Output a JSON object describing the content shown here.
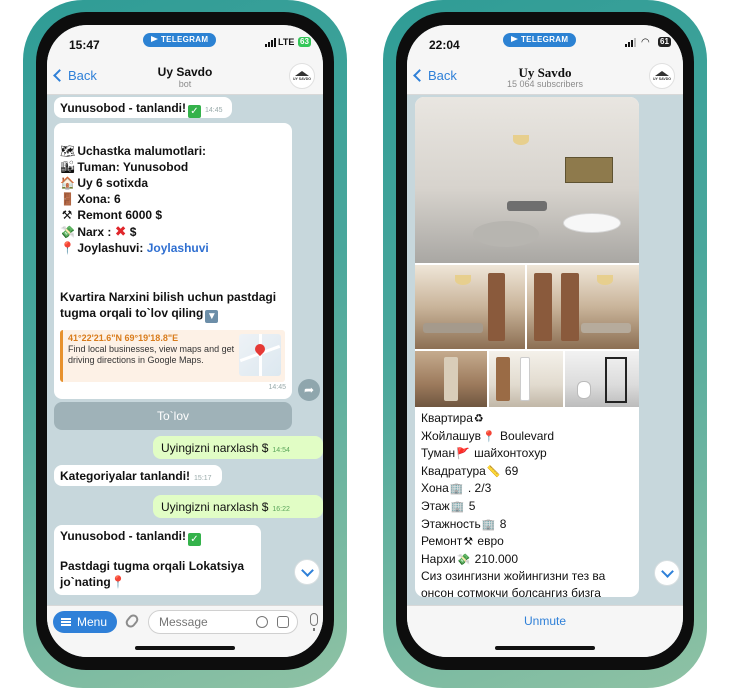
{
  "colors": {
    "accent": "#2f80d8",
    "outgoing": "#e1fdc5",
    "check": "#34b24b",
    "phone_frame": "#2f9c96"
  },
  "left": {
    "status": {
      "time": "15:47",
      "network": "LTE",
      "battery": "63",
      "app_pill": "TELEGRAM"
    },
    "nav": {
      "back": "Back",
      "title": "Uy Savdo",
      "subtitle": "bot"
    },
    "messages": {
      "m1": {
        "text": "Yunusobod - tanlandi!",
        "time": "14:45"
      },
      "m2": {
        "line1": "Uchastka malumotlari:",
        "line2": "Tuman: Yunusobod",
        "line3": "Uy 6 sotixda",
        "line4": "Xona: 6",
        "line5": "Remont 6000 $",
        "line6": "Narx :",
        "line6b": "$",
        "line7": "Joylashuvi:",
        "line7_link": "Joylashuvi",
        "para1": "Kvartira Narxini bilish uchun pastdagi",
        "para2": "tugma orqali to`lov qiling",
        "map_coords": "41°22'21.6\"N 69°19'18.8\"E",
        "map_desc": "Find local businesses, view maps and get driving directions in Google Maps.",
        "time": "14:45"
      },
      "button": "To`lov",
      "m3": {
        "text": "Uyingizni narxlash $",
        "time": "14:54"
      },
      "m4": {
        "text": "Kategoriyalar tanlandi!",
        "time": "15:17"
      },
      "m5": {
        "text": "Uyingizni narxlash $",
        "time": "16:22"
      },
      "m6": {
        "line1": "Yunusobod - tanlandi!",
        "line2": "Pastdagi tugma orqali Lokatsiya",
        "line3": "jo`nating",
        "time": "16:22"
      }
    },
    "input": {
      "menu": "Menu",
      "placeholder": "Message"
    }
  },
  "right": {
    "status": {
      "time": "22:04",
      "battery": "61",
      "app_pill": "TELEGRAM"
    },
    "nav": {
      "back": "Back",
      "title": "Uy Savdo",
      "subtitle": "15 064 subscribers"
    },
    "post": [
      {
        "label": "Квартира",
        "icon": "♻",
        "value": ""
      },
      {
        "label": "Жойлашув",
        "icon": "📍",
        "value": "Boulevard"
      },
      {
        "label": "Туман",
        "icon": "🚩",
        "value": "шайхонтохур"
      },
      {
        "label": "Квадратура",
        "icon": "📏",
        "value": "69"
      },
      {
        "label": "Хона",
        "icon": "🏢",
        "value": ". 2/3"
      },
      {
        "label": "Этаж",
        "icon": "🏢",
        "value": "5"
      },
      {
        "label": "Этажность",
        "icon": "🏢",
        "value": "8"
      },
      {
        "label": "Ремонт",
        "icon": "⚒",
        "value": "евро"
      },
      {
        "label": "Нархи",
        "icon": "💸",
        "value": "210.000"
      }
    ],
    "post_tail1": "Сиз озингизни жойингизни тез ва",
    "post_tail2": "онсон сотмокчи болсангиз бизга",
    "unmute": "Unmute"
  }
}
